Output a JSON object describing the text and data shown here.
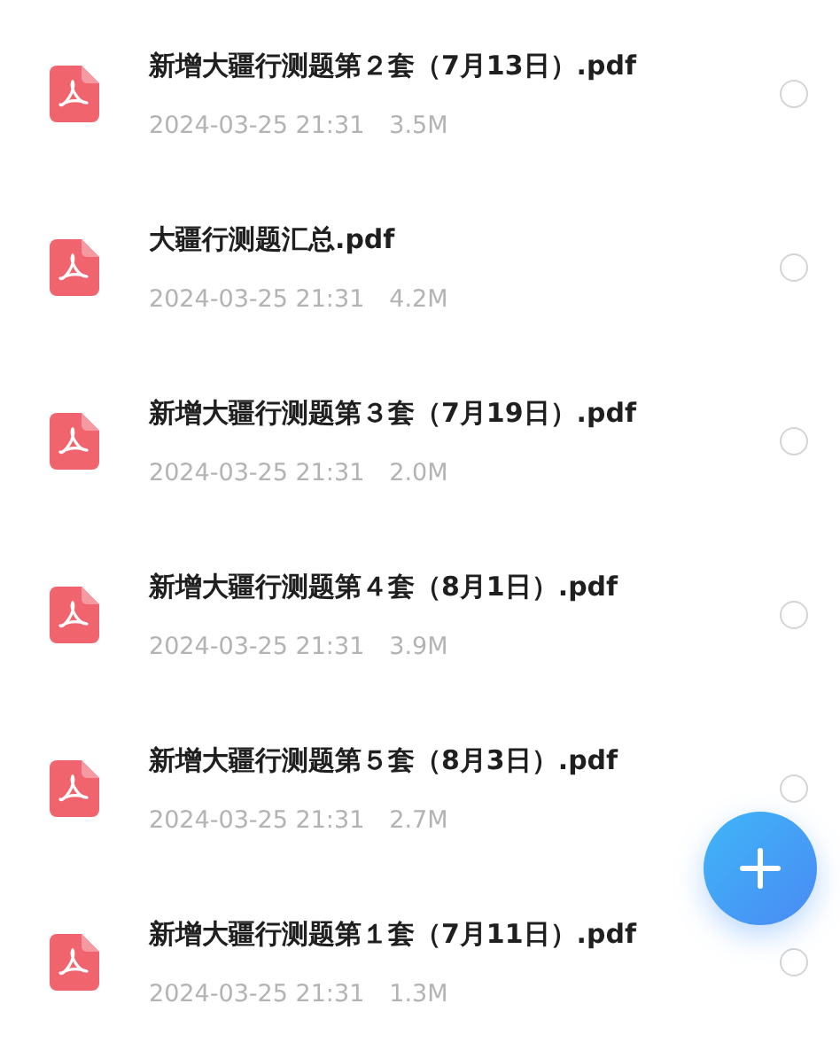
{
  "files": [
    {
      "name": "新增大疆行测题第２套（7月13日）.pdf",
      "date": "2024-03-25 21:31",
      "size": "3.5M",
      "selected": false
    },
    {
      "name": "大疆行测题汇总.pdf",
      "date": "2024-03-25 21:31",
      "size": "4.2M",
      "selected": false
    },
    {
      "name": "新增大疆行测题第３套（7月19日）.pdf",
      "date": "2024-03-25 21:31",
      "size": "2.0M",
      "selected": false
    },
    {
      "name": "新增大疆行测题第４套（8月1日）.pdf",
      "date": "2024-03-25 21:31",
      "size": "3.9M",
      "selected": false
    },
    {
      "name": "新增大疆行测题第５套（8月3日）.pdf",
      "date": "2024-03-25 21:31",
      "size": "2.7M",
      "selected": false
    },
    {
      "name": "新增大疆行测题第１套（7月11日）.pdf",
      "date": "2024-03-25 21:31",
      "size": "1.3M",
      "selected": false
    }
  ]
}
